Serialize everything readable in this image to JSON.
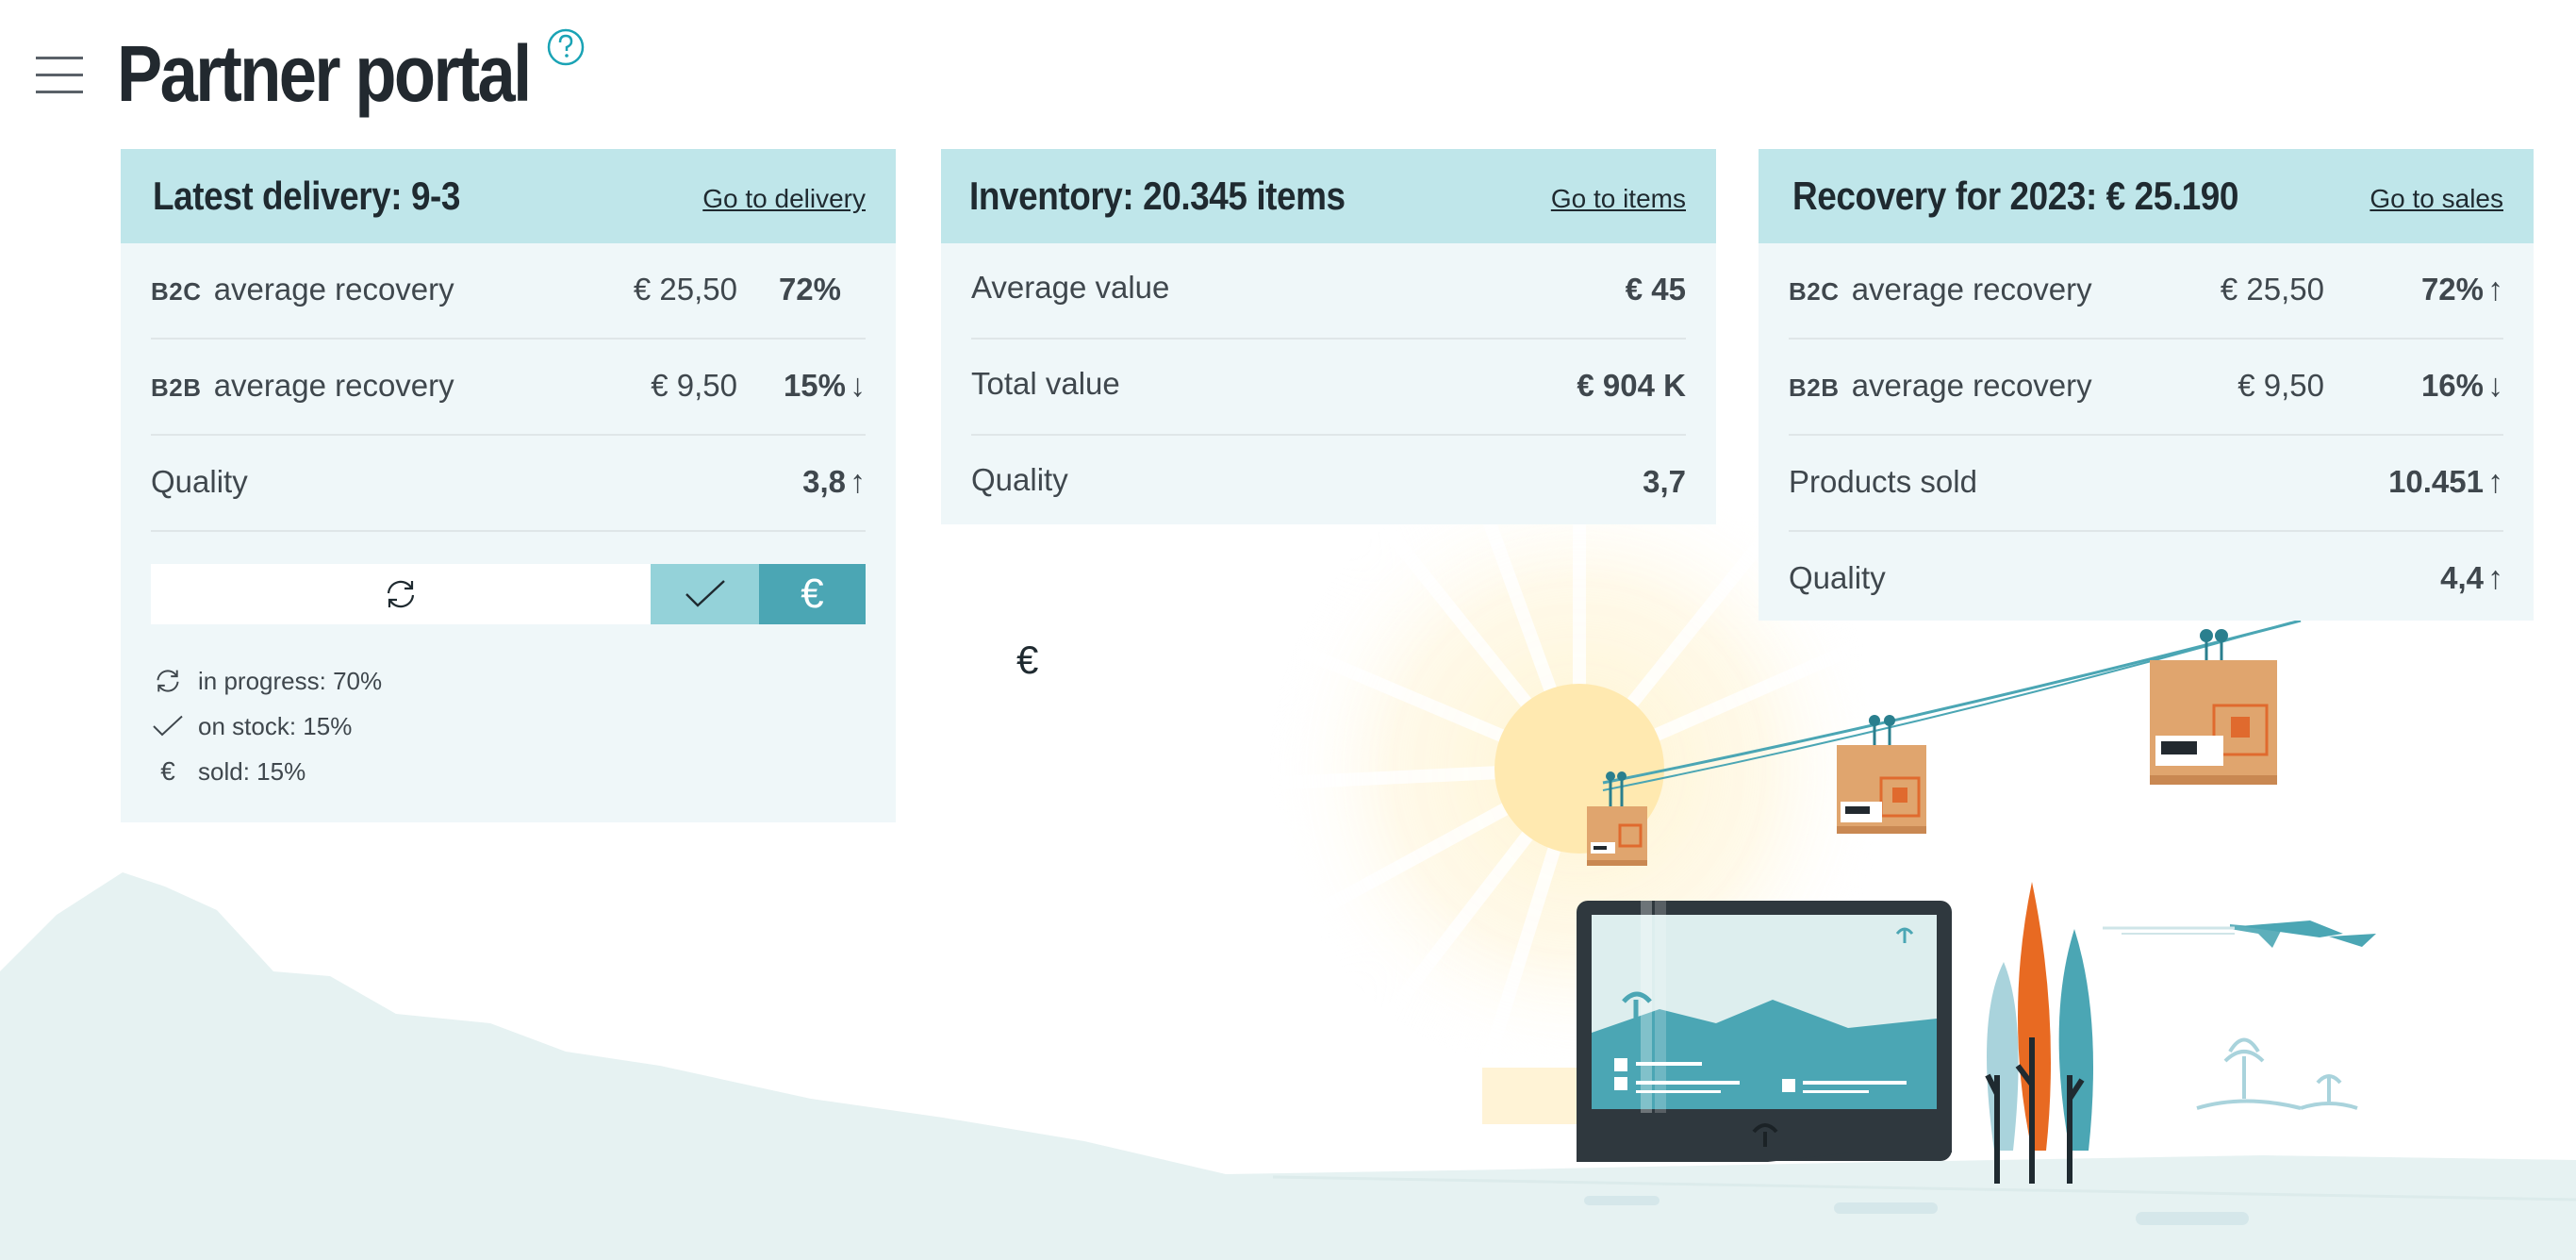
{
  "header": {
    "title": "Partner portal",
    "menu_icon": "hamburger-menu-icon",
    "help_icon": "question-circle-icon"
  },
  "cards": {
    "delivery": {
      "title": "Latest delivery: 9-3",
      "link": "Go to delivery",
      "rows": [
        {
          "tag": "B2C",
          "label": "average recovery",
          "amount": "€ 25,50",
          "value": "72%",
          "arrow": ""
        },
        {
          "tag": "B2B",
          "label": "average recovery",
          "amount": "€ 9,50",
          "value": "15%",
          "arrow": "↓"
        },
        {
          "tag": "",
          "label": "Quality",
          "amount": "",
          "value": "3,8",
          "arrow": "↑"
        }
      ],
      "status_bar": {
        "segments": [
          {
            "key": "in_progress",
            "icon": "refresh-icon",
            "percent": 70
          },
          {
            "key": "on_stock",
            "icon": "check-icon",
            "percent": 15
          },
          {
            "key": "sold",
            "icon": "euro-icon",
            "percent": 15
          }
        ],
        "sold_symbol": "€"
      },
      "legend": [
        {
          "icon": "refresh-icon",
          "text": "in progress: 70%"
        },
        {
          "icon": "check-icon",
          "text": "on stock: 15%"
        },
        {
          "icon": "euro-icon",
          "symbol": "€",
          "text": "sold: 15%"
        }
      ]
    },
    "inventory": {
      "title": "Inventory: 20.345 items",
      "link": "Go to items",
      "rows": [
        {
          "label": "Average value",
          "value": "€ 45"
        },
        {
          "label": "Total value",
          "value": "€ 904 K"
        },
        {
          "label": "Quality",
          "value": "3,7"
        }
      ]
    },
    "recovery": {
      "title": "Recovery for 2023: € 25.190",
      "link": "Go to sales",
      "rows": [
        {
          "tag": "B2C",
          "label": "average recovery",
          "amount": "€ 25,50",
          "value": "72%",
          "arrow": "↑"
        },
        {
          "tag": "B2B",
          "label": "average recovery",
          "amount": "€ 9,50",
          "value": "16%",
          "arrow": "↓"
        },
        {
          "tag": "",
          "label": "Products sold",
          "amount": "",
          "value": "10.451",
          "arrow": "↑"
        },
        {
          "tag": "",
          "label": "Quality",
          "amount": "",
          "value": "4,4",
          "arrow": "↑"
        }
      ]
    }
  },
  "floating_symbol": "€",
  "colors": {
    "card_header": "#bfe6ea",
    "card_body": "#eff7f9",
    "accent": "#4ba6b4",
    "accent_light": "#94d2d9",
    "help": "#1aa3b5"
  }
}
